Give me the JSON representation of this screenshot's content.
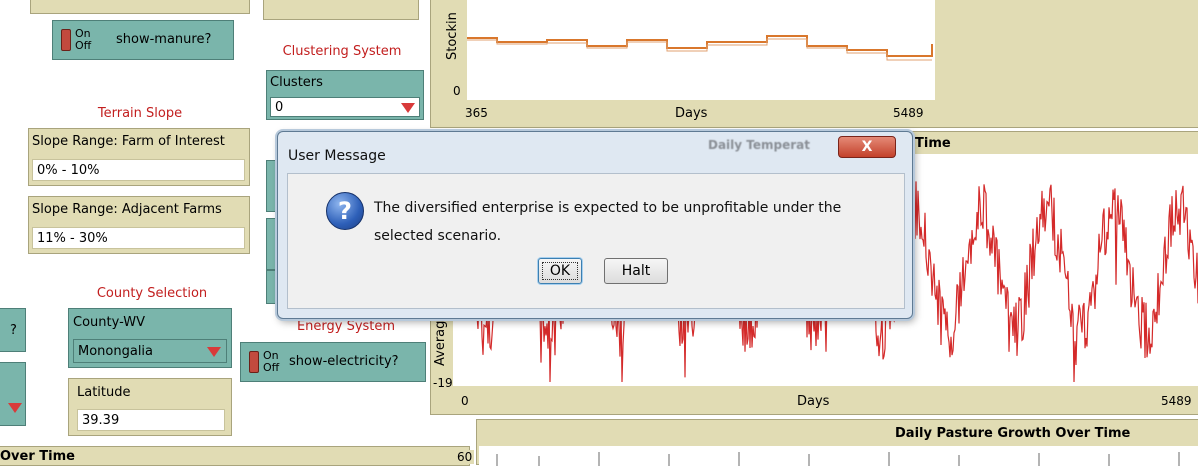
{
  "switch_manure": {
    "on": "On",
    "off": "Off",
    "label": "show-manure?"
  },
  "clustering": {
    "heading": "Clustering System",
    "chooser_label": "Clusters",
    "chooser_value": "0"
  },
  "terrain": {
    "heading": "Terrain Slope"
  },
  "slope_farm": {
    "label": "Slope Range: Farm of Interest",
    "value": "0% - 10%"
  },
  "slope_adjacent": {
    "label": "Slope Range: Adjacent Farms",
    "value": "11% - 30%"
  },
  "county": {
    "heading": "County Selection",
    "chooser_label": "County-WV",
    "chooser_value": "Monongalia"
  },
  "latitude": {
    "label": "Latitude",
    "value": "39.39"
  },
  "energy": {
    "heading": "Energy System"
  },
  "switch_electricity": {
    "on": "On",
    "off": "Off",
    "label": "show-electricity?"
  },
  "left_edge": {
    "q_mark": "?"
  },
  "bottom_left": {
    "title": "Over Time"
  },
  "stocking_plot": {
    "ylabel": "Stockin",
    "y_min": "0",
    "x_min": "365",
    "x_max": "5489",
    "xlabel": "Days"
  },
  "temperature_plot": {
    "title": "Time",
    "ylabel": "Averag",
    "y_min": "-19",
    "x_min": "0",
    "x_max": "5489",
    "xlabel": "Days"
  },
  "pasture_plot": {
    "title": "Daily Pasture Growth Over Time",
    "y_max": "60"
  },
  "dialog": {
    "title": "User Message",
    "close_label": "X",
    "behind_title": "Daily Temperat",
    "icon_glyph": "?",
    "message": "The diversified enterprise is expected to be unprofitable under the selected scenario.",
    "ok_label": "OK",
    "halt_label": "Halt"
  },
  "colors": {
    "panel_tan": "#e1dcb4",
    "widget_teal": "#7ab5ab",
    "heading_red": "#c21e1e",
    "temp_series": "#d42a2a",
    "stock_series": "#d9772c"
  }
}
